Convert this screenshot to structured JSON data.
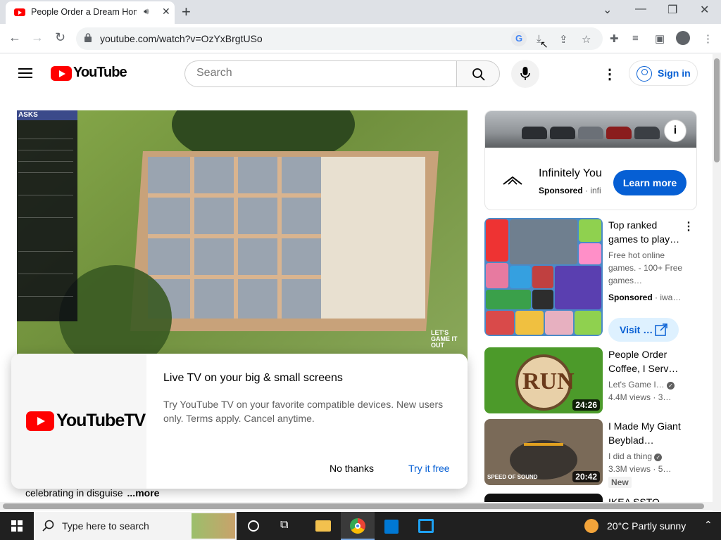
{
  "browser": {
    "tab_title": "People Order a Dream Home",
    "tab_audio_icon": "speaker-icon",
    "new_tab": "+",
    "url": "youtube.com/watch?v=OzYxBrgtUSo",
    "window_min": "—",
    "window_restore": "❐",
    "window_close": "✕",
    "chevron": "⌄"
  },
  "youtube": {
    "wordmark": "YouTube",
    "search_placeholder": "Search",
    "sign_in": "Sign in"
  },
  "video": {
    "panel_header": "ASKS",
    "badge": "LET'S GAME IT OUT"
  },
  "promo": {
    "brand": "YouTubeTV",
    "title": "Live TV on your big & small screens",
    "description": "Try YouTube TV on your favorite compatible devices. New users only. Terms apply. Cancel anytime.",
    "no_thanks": "No thanks",
    "try_free": "Try it free"
  },
  "description_snippet": {
    "text": "celebrating in disguise",
    "more": "...more"
  },
  "sidebar": {
    "ad": {
      "title": "Infinitely You",
      "sponsored": "Sponsored",
      "advertiser": "infi",
      "cta": "Learn more"
    },
    "items": [
      {
        "title": "Top ranked games to play…",
        "desc": "Free hot online games. - 100+ Free games…",
        "sponsored": "Sponsored",
        "advertiser": "iwa…",
        "cta": "Visit …"
      },
      {
        "title": "People Order Coffee, I Serv…",
        "channel": "Let's Game I…",
        "views": "4.4M views",
        "age": "3…",
        "duration": "24:26",
        "thumb_text": "RUN"
      },
      {
        "title": "I Made My Giant Beyblad…",
        "channel": "I did a thing",
        "views": "3.3M views",
        "age": "5…",
        "duration": "20:42",
        "badge": "New",
        "thumb_text": "SPEED OF SOUND"
      },
      {
        "title": "IKEA SSTO"
      }
    ]
  },
  "taskbar": {
    "search_placeholder": "Type here to search",
    "weather": "20°C  Partly sunny"
  }
}
